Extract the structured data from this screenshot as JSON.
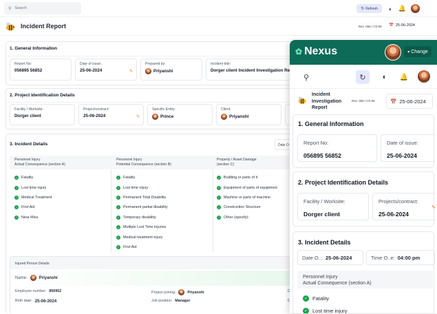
{
  "topbar": {
    "search_placeholder": "Search",
    "refresh_label": "Refresh"
  },
  "report": {
    "title": "Incident Report",
    "rev": "Rev. 058 / Ch-08",
    "date": "25-06-2024"
  },
  "general": {
    "heading": "1. General Information",
    "report_no_label": "Report No:",
    "report_no": "056895 56852",
    "date_issue_label": "Date of issue:",
    "date_issue": "25-06-2024",
    "prepared_label": "Prepared by:",
    "prepared": "Priyanshi",
    "incident_title_label": "Incident title:",
    "incident_title": "Dorger client Incident Investigation Re"
  },
  "project": {
    "heading": "2. Project Identification Details",
    "facility_label": "Facility / Worksite:",
    "facility": "Dorger client",
    "contract_label": "Project/contract:",
    "contract": "25-06-2024",
    "entity_label": "Specific Entity:",
    "entity": "Prince",
    "client_label": "Client:",
    "client": "Priyanshi",
    "cut_label": "Co"
  },
  "incident": {
    "heading": "3. Incident Details",
    "date_chip": "Date O",
    "col_a_line1": "Personnel Injury",
    "col_a_line2": "Actual Consequence (section A)",
    "col_b_line1": "Personnel Injury",
    "col_b_line2": "Potential Consequence (section B)",
    "col_c_line1": "Property / Asset Damage",
    "col_c_line2": "(section C)",
    "col_a": [
      "Fatality",
      "Lost time injury",
      "Medical Treatment",
      "First Aid",
      "Near Miss"
    ],
    "col_b": [
      "Fatality",
      "Lost time injury",
      "Permanent Total Disability",
      "Permanent partial disability",
      "Temporary disability",
      "Multiple Lost Time Injuries",
      "Medical treatment injury",
      "First Aid"
    ],
    "col_c": [
      "Building or parts of it",
      "Equipment of parts of equipment",
      "Machine or parts of machine",
      "Construction Structure",
      "Other (specify):"
    ]
  },
  "injured": {
    "heading": "Injured Person Details:",
    "name_label": "Name:",
    "name": "Priyanshi",
    "emp_label": "Employee number:",
    "emp": "856952",
    "birth_label": "Birth date:",
    "birth": "25-06-2024",
    "joining_label": "Project joining:",
    "joining": "Priyanshi",
    "job_label": "Job position:",
    "job": "Manager",
    "cut1": "Dr",
    "cut2": "Dr"
  },
  "mobile": {
    "brand": "Nexus",
    "change_label": "Change",
    "title_l1": "Incident",
    "title_l2": "Investigation",
    "title_l3": "Report",
    "rev": "Rev. 058 / Ch-08",
    "date": "25-06-2024",
    "general_heading": "1. General Information",
    "report_no_label": "Report No:",
    "report_no": "056895 56852",
    "date_issue_label": "Date of issue:",
    "date_issue": "25-06-2024",
    "project_heading": "2. Project Identification Details",
    "facility_label": "Facility / Worksite:",
    "facility": "Dorger client",
    "contract_label": "Projects/contract:",
    "contract": "25-06-2024",
    "incident_heading": "3. Incident Details",
    "date_o_label": "Date O..:",
    "date_o": "25-06-2024",
    "time_o_label": "Time O..e:",
    "time_o": "04:00 pm",
    "consequence_l1": "Personnel Injury",
    "consequence_l2": "Actual Consequence (section A)",
    "items": [
      "Fatality",
      "Lost time injury"
    ]
  },
  "colors": {
    "brand": "#0e6b57",
    "accent": "#f97316",
    "check": "#16a34a"
  }
}
